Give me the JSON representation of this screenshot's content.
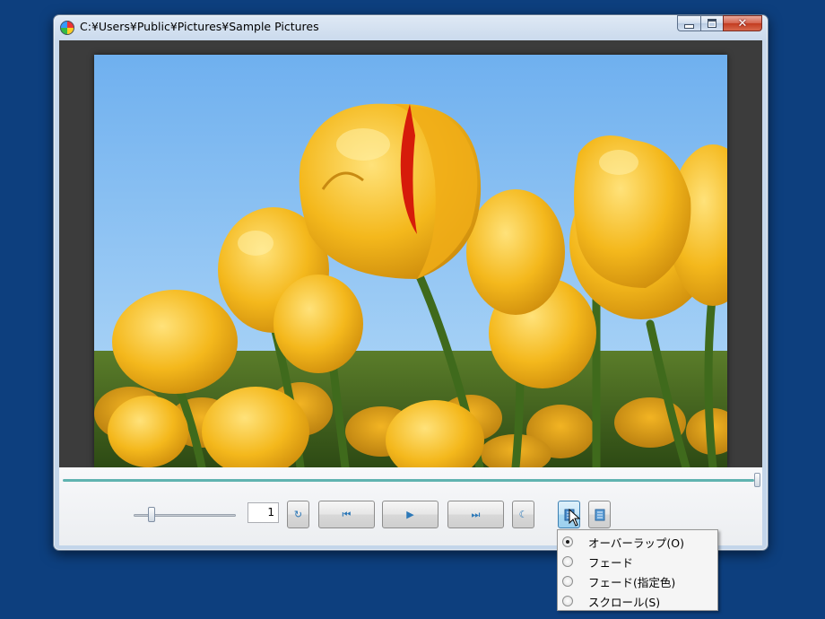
{
  "window": {
    "title": "C:¥Users¥Public¥Pictures¥Sample Pictures",
    "icon": "slideshow-app-icon",
    "caption_buttons": [
      "minimize-icon",
      "maximize-icon",
      "close-icon"
    ],
    "close_glyph": "✕"
  },
  "viewer": {
    "image_subject": "yellow tulips against blue sky"
  },
  "controls": {
    "seek_position": 1.0,
    "volume_level": 0.17,
    "page_number": "1",
    "buttons": {
      "rotate": "refresh-icon",
      "previous": "skip-previous-icon",
      "play": "play-icon",
      "next": "skip-next-icon",
      "night": "moon-icon",
      "transition": "transition-settings-icon",
      "list": "list-icon"
    },
    "glyphs": {
      "rotate": "↻",
      "previous": "⏮",
      "play": "▶",
      "next": "⏭",
      "night": "☾"
    }
  },
  "transition_menu": {
    "items": [
      {
        "label": "オーバーラップ(O)",
        "checked": true
      },
      {
        "label": "フェード",
        "checked": false
      },
      {
        "label": "フェード(指定色)",
        "checked": false
      },
      {
        "label": "スクロール(S)",
        "checked": false
      }
    ]
  },
  "colors": {
    "desktop": "#0d3f7e",
    "seek_accent": "#5fb3b0",
    "button_icon": "#2c78b8"
  }
}
